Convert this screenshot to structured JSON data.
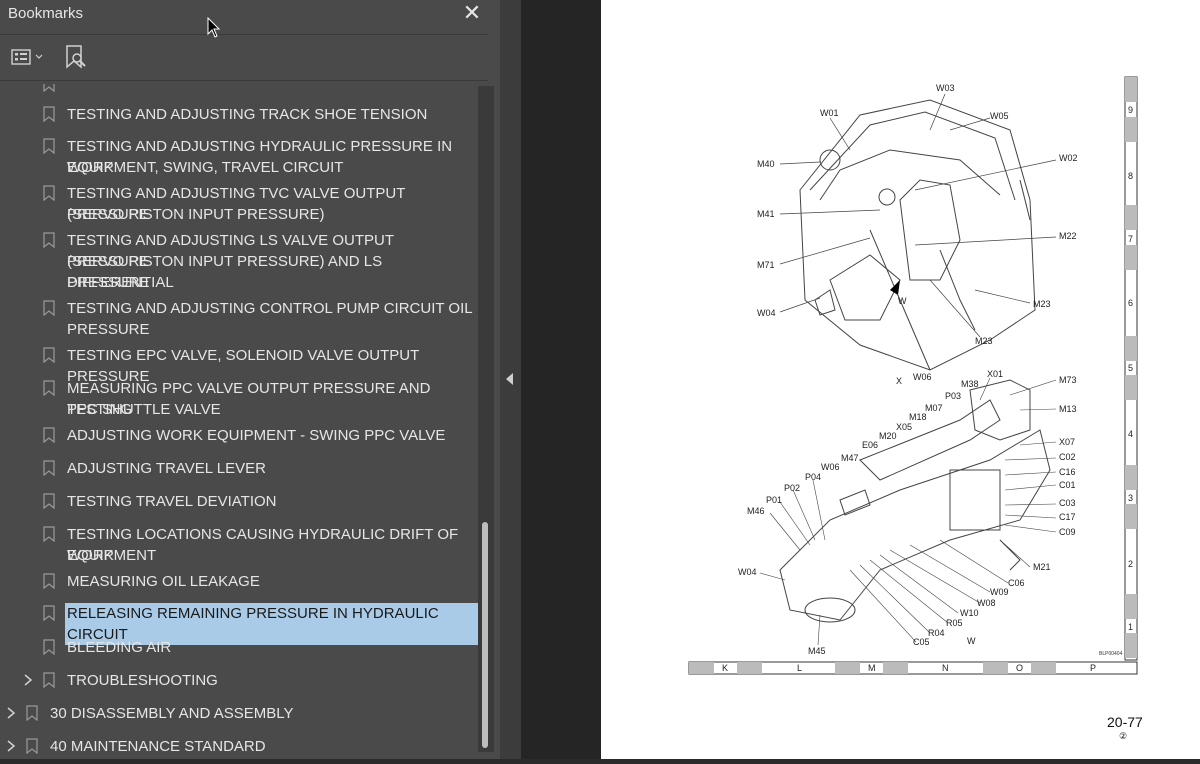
{
  "sidebar": {
    "title": "Bookmarks",
    "close_icon": "close-icon",
    "toolbar": {
      "options_icon": "list-options-icon",
      "find_icon": "find-bookmark-icon"
    }
  },
  "bookmarks": [
    {
      "label": "TESTING AND ADJUSTING TRACK SHOE TENSION"
    },
    {
      "label": "TESTING AND ADJUSTING HYDRAULIC PRESSURE IN WORK",
      "label2": "EQUIPMENT, SWING, TRAVEL CIRCUIT"
    },
    {
      "label": "TESTING AND ADJUSTING TVC VALVE OUTPUT PRESSURE",
      "label2": "(SERVO PISTON INPUT PRESSURE)"
    },
    {
      "label": "TESTING AND ADJUSTING LS VALVE OUTPUT PRESSURE",
      "label2": "(SERVO PISTON INPUT PRESSURE) AND LS DIFFERENTIAL",
      "label3": "PRESSURE"
    },
    {
      "label": "TESTING AND ADJUSTING CONTROL PUMP CIRCUIT OIL",
      "label2": "PRESSURE"
    },
    {
      "label": "TESTING EPC VALVE, SOLENOID VALVE OUTPUT PRESSURE"
    },
    {
      "label": "MEASURING PPC VALVE OUTPUT PRESSURE AND TESTING",
      "label2": "PPC SHUTTLE VALVE"
    },
    {
      "label": "ADJUSTING WORK EQUIPMENT - SWING PPC VALVE"
    },
    {
      "label": "ADJUSTING TRAVEL LEVER"
    },
    {
      "label": "TESTING TRAVEL DEVIATION"
    },
    {
      "label": "TESTING LOCATIONS CAUSING HYDRAULIC DRIFT OF WORK",
      "label2": "EQUIPMENT"
    },
    {
      "label": "MEASURING OIL LEAKAGE"
    },
    {
      "label": "RELEASING REMAINING PRESSURE IN HYDRAULIC CIRCUIT",
      "selected": true
    },
    {
      "label": "BLEEDING AIR"
    },
    {
      "label": "TROUBLESHOOTING"
    },
    {
      "label": "30 DISASSEMBLY AND ASSEMBLY"
    },
    {
      "label": "40 MAINTENANCE STANDARD"
    }
  ],
  "page": {
    "page_number": "20-77",
    "page_sub": "②",
    "diagram_code": "BLP00404",
    "top_labels": [
      "W03",
      "W01",
      "W05",
      "M40",
      "W02",
      "M41",
      "M22",
      "M71",
      "W",
      "W04",
      "M23",
      "M23",
      "X",
      "W06"
    ],
    "bottom_labels": [
      "X01",
      "M73",
      "M38",
      "P03",
      "M13",
      "M07",
      "M18",
      "X05",
      "M20",
      "E06",
      "X07",
      "C02",
      "M47",
      "W06",
      "C16",
      "C01",
      "P04",
      "P02",
      "C03",
      "P01",
      "C17",
      "M46",
      "C09",
      "M21",
      "W04",
      "C06",
      "W09",
      "W08",
      "W10",
      "R05",
      "R04",
      "C05",
      "W",
      "M45"
    ],
    "border_letters": [
      "K",
      "L",
      "M",
      "N",
      "O",
      "P"
    ],
    "border_numbers": [
      "9",
      "8",
      "7",
      "6",
      "5",
      "4",
      "3",
      "2",
      "1"
    ]
  }
}
